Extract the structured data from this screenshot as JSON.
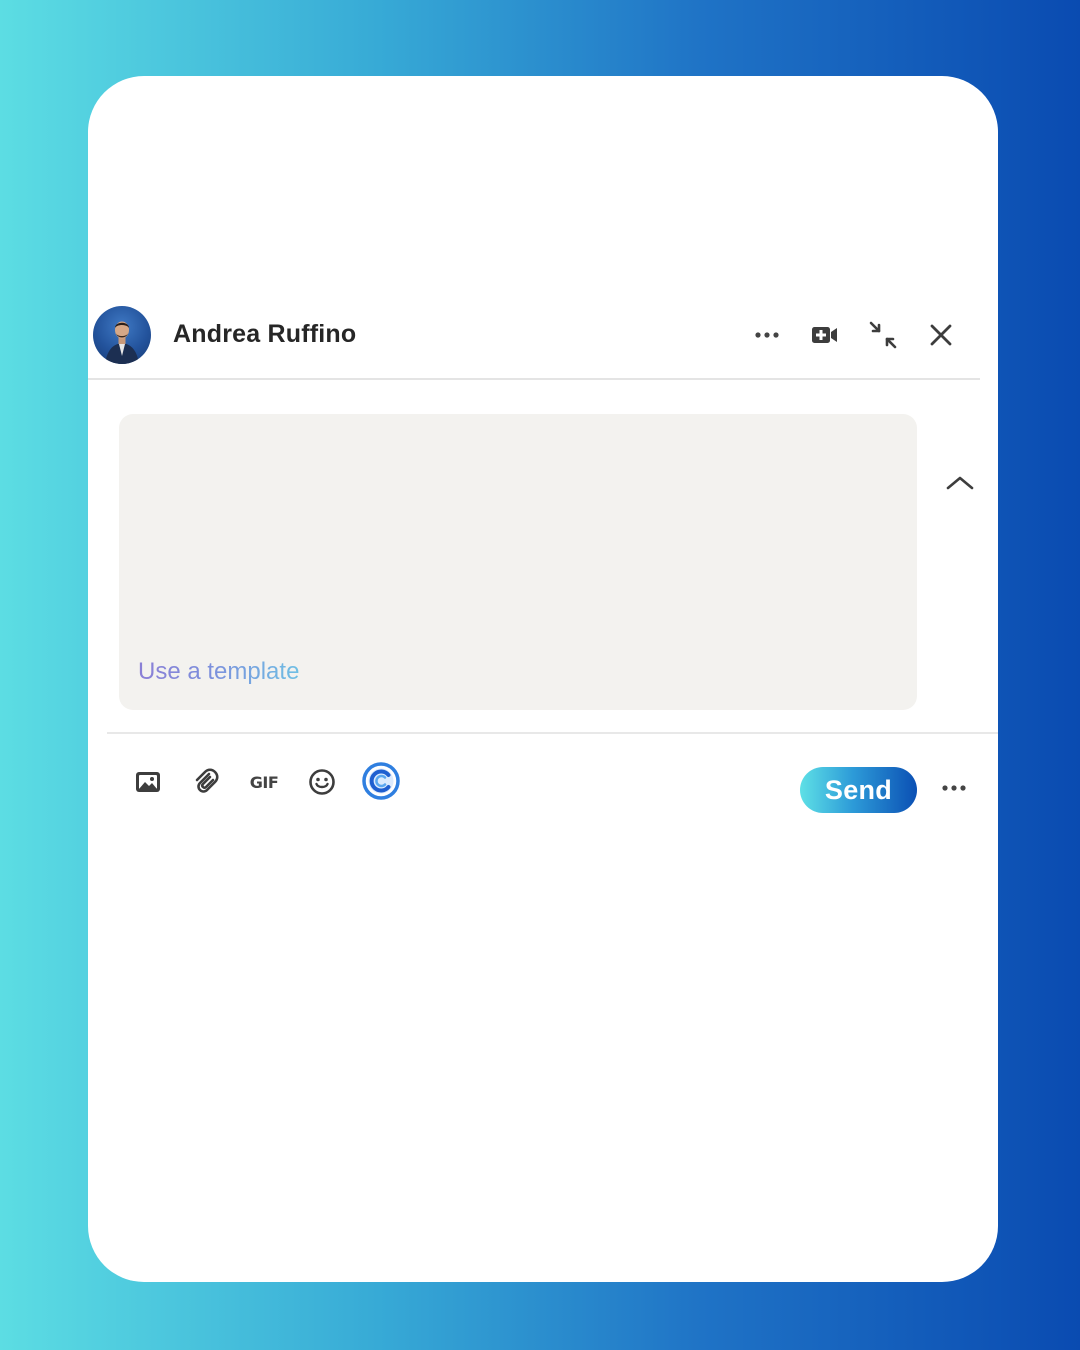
{
  "conversation": {
    "contact_name": "Andrea Ruffino"
  },
  "header": {
    "icons": [
      "more-options-icon",
      "video-call-icon",
      "minimize-icon",
      "close-icon"
    ]
  },
  "composer": {
    "message_value": "",
    "template_link_label": "Use a template"
  },
  "toolbar": {
    "icons": [
      "image-icon",
      "attachment-icon",
      "gif-icon",
      "emoji-icon",
      "extension-icon"
    ],
    "gif_label": "GIF",
    "send_label": "Send"
  },
  "colors": {
    "background_gradient": [
      "#5cdde3",
      "#0a4bb1"
    ],
    "composer_bg": "#f3f2ef",
    "send_gradient": [
      "#5ee0e6",
      "#0b50b4"
    ],
    "template_link": "#8b7fd6"
  }
}
